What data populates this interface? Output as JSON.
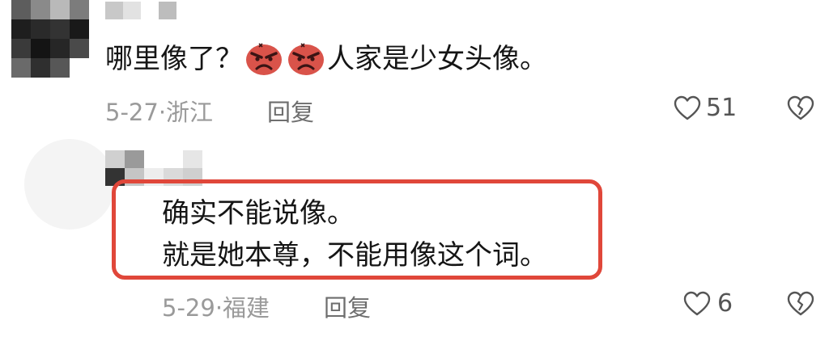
{
  "comments": [
    {
      "text_before": "哪里像了？",
      "emojis": [
        "angry-face-icon",
        "angry-face-icon"
      ],
      "text_after": "人家是少女头像。",
      "date_location": "5-27·浙江",
      "reply_label": "回复",
      "likes": "51"
    },
    {
      "lines": [
        "确实不能说像。",
        "就是她本尊，不能用像这个词。"
      ],
      "date_location": "5-29·福建",
      "reply_label": "回复",
      "likes": "6"
    }
  ],
  "colors": {
    "highlight_border": "#e0473a",
    "emoji_face": "#d9534a",
    "meta_text": "#9a9a9a",
    "icon_stroke": "#555555"
  }
}
